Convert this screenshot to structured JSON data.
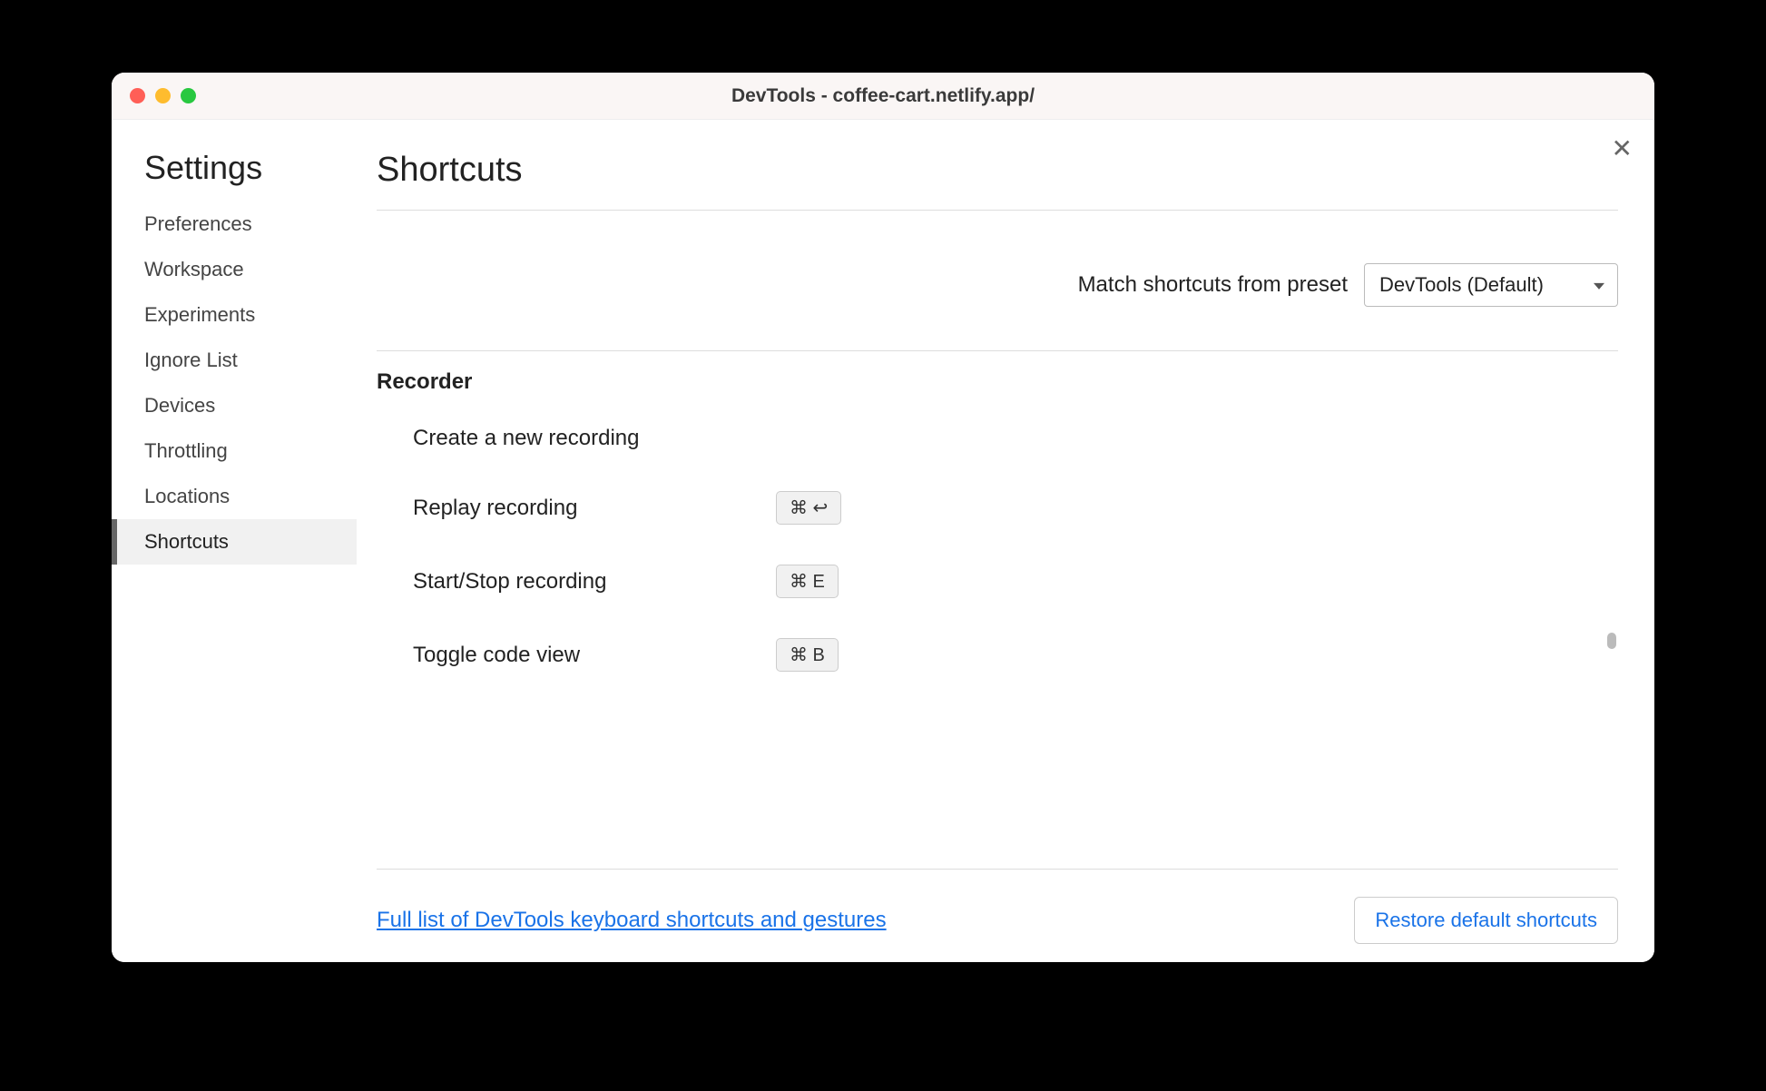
{
  "window": {
    "title": "DevTools - coffee-cart.netlify.app/"
  },
  "sidebar": {
    "heading": "Settings",
    "items": [
      {
        "label": "Preferences"
      },
      {
        "label": "Workspace"
      },
      {
        "label": "Experiments"
      },
      {
        "label": "Ignore List"
      },
      {
        "label": "Devices"
      },
      {
        "label": "Throttling"
      },
      {
        "label": "Locations"
      },
      {
        "label": "Shortcuts",
        "selected": true
      }
    ]
  },
  "page": {
    "title": "Shortcuts",
    "preset_label": "Match shortcuts from preset",
    "preset_value": "DevTools (Default)"
  },
  "section": {
    "title": "Recorder",
    "shortcuts": [
      {
        "label": "Create a new recording",
        "keys": ""
      },
      {
        "label": "Replay recording",
        "keys": "⌘  ↩"
      },
      {
        "label": "Start/Stop recording",
        "keys": "⌘  E"
      },
      {
        "label": "Toggle code view",
        "keys": "⌘  B"
      }
    ]
  },
  "footer": {
    "link_label": "Full list of DevTools keyboard shortcuts and gestures",
    "restore_label": "Restore default shortcuts"
  },
  "close_glyph": "✕"
}
